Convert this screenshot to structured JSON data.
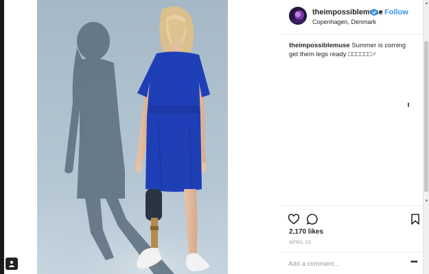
{
  "post": {
    "username": "theimpossiblemuse",
    "follow_label": "Follow",
    "separator": "•",
    "location": "Copenhagen, Denmark",
    "caption_text": "Summer is coming get them legs ready □□□□□□♂",
    "likes": "2,170 likes",
    "date": "APRIL 23",
    "comment_placeholder": "Add a comment...",
    "more_label": "•••",
    "caption_overflow_mark": "ı"
  },
  "icons": {
    "verified": "verified-badge-icon",
    "like": "heart-icon",
    "comment": "comment-bubble-icon",
    "save": "bookmark-icon",
    "more": "more-options-icon",
    "profile_corner": "person-icon"
  },
  "colors": {
    "dress": "#1f3fb6",
    "backdrop": "#a9bccc",
    "link": "#3897f0",
    "text": "#262626",
    "muted": "#999999"
  }
}
